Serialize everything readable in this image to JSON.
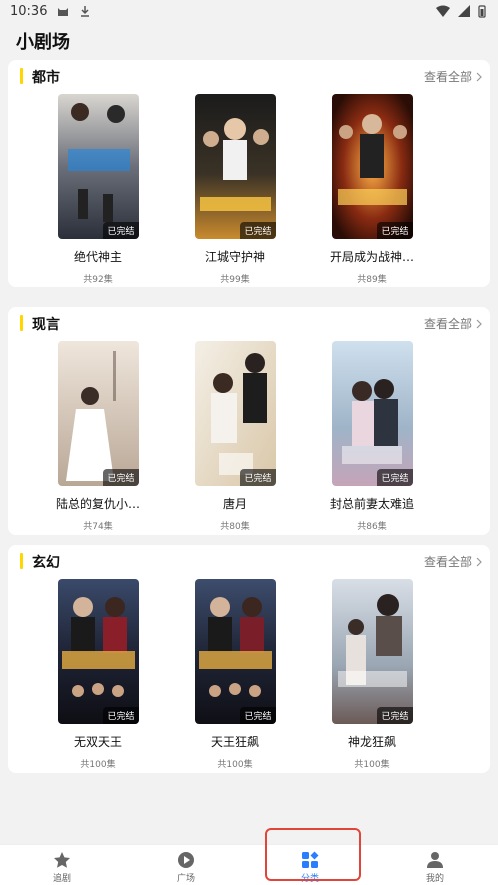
{
  "status": {
    "time": "10:36"
  },
  "page_title": "小剧场",
  "sections": [
    {
      "title": "都市",
      "view_all": "查看全部",
      "items": [
        {
          "title": "绝代神主",
          "count": "共92集",
          "badge": "已完结"
        },
        {
          "title": "江城守护神",
          "count": "共99集",
          "badge": "已完结"
        },
        {
          "title": "开局成为战神…",
          "count": "共89集",
          "badge": "已完结"
        }
      ]
    },
    {
      "title": "现言",
      "view_all": "查看全部",
      "items": [
        {
          "title": "陆总的复仇小…",
          "count": "共74集",
          "badge": "已完结"
        },
        {
          "title": "唐月",
          "count": "共80集",
          "badge": "已完结"
        },
        {
          "title": "封总前妻太难追",
          "count": "共86集",
          "badge": "已完结"
        }
      ]
    },
    {
      "title": "玄幻",
      "view_all": "查看全部",
      "items": [
        {
          "title": "无双天王",
          "count": "共100集",
          "badge": "已完结"
        },
        {
          "title": "天王狂飙",
          "count": "共100集",
          "badge": "已完结"
        },
        {
          "title": "神龙狂飙",
          "count": "共100集",
          "badge": "已完结"
        }
      ]
    }
  ],
  "nav": [
    {
      "label": "追剧",
      "icon": "star-icon"
    },
    {
      "label": "广场",
      "icon": "play-icon"
    },
    {
      "label": "分类",
      "icon": "category-icon",
      "active": true
    },
    {
      "label": "我的",
      "icon": "person-icon"
    }
  ],
  "colors": {
    "accent": "#ffd600",
    "nav_active": "#2b7cff",
    "highlight": "#e0453a"
  }
}
